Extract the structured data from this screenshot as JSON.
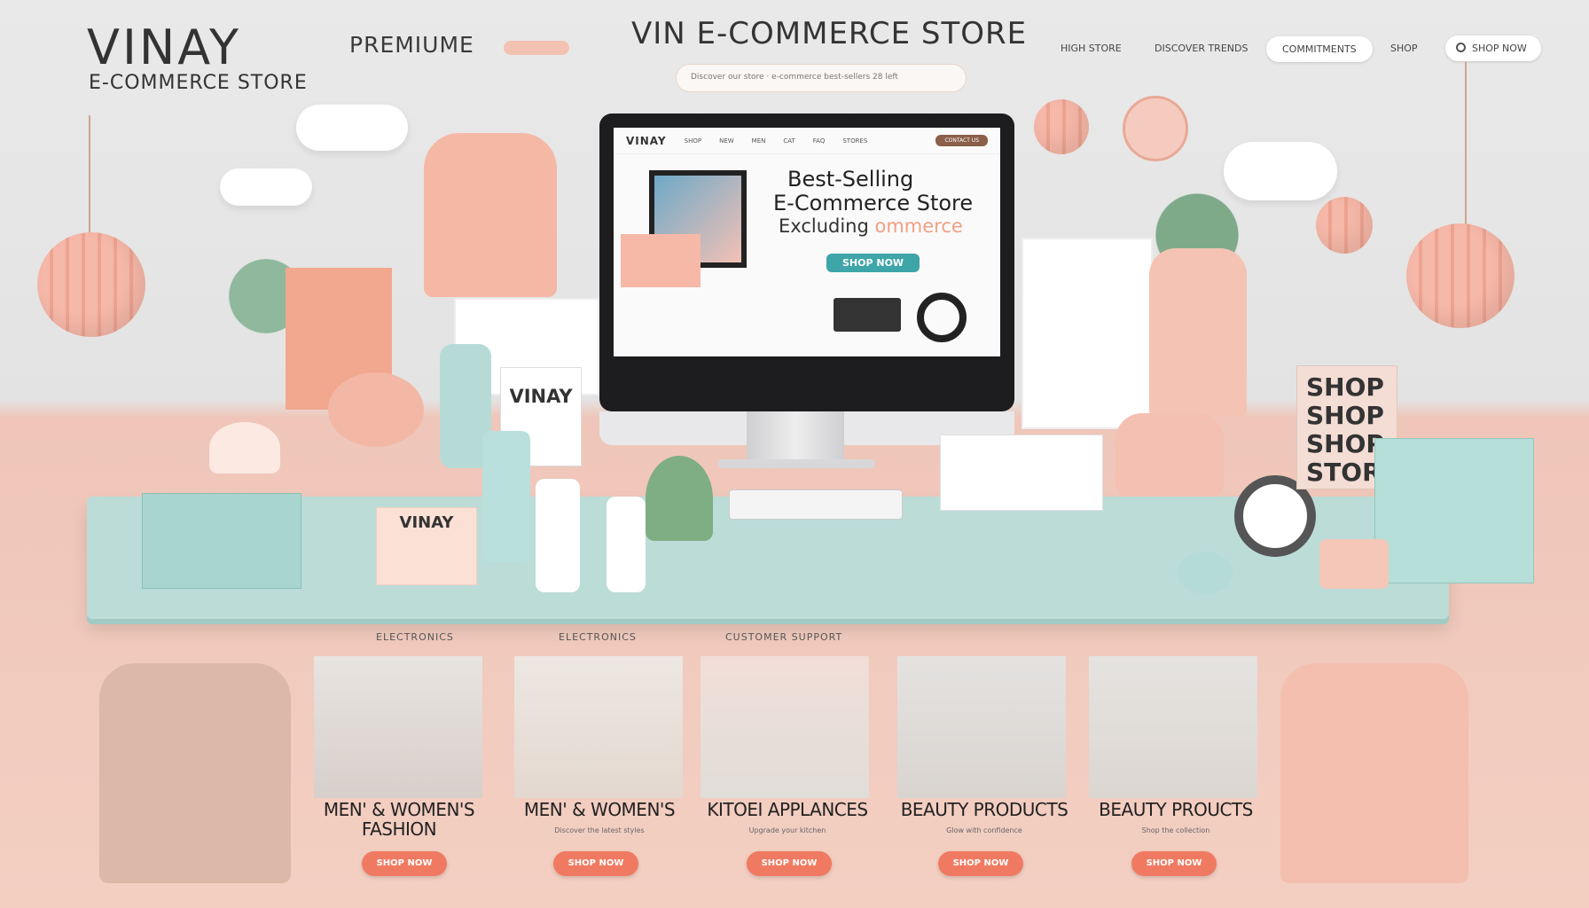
{
  "brand": {
    "name": "VINAY",
    "tagline": "E-COMMERCE STORE"
  },
  "header": {
    "premium_label": "PREMIUME",
    "title": "VIN E-COMMERCE STORE",
    "nav": [
      "HIGH STORE",
      "DISCOVER TRENDS",
      "COMMITMENTS",
      "SHOP",
      "SHOP NOW"
    ],
    "search_placeholder": "Discover our store · e-commerce best-sellers 28 left"
  },
  "screen": {
    "logo": "VINAY",
    "nav": [
      "SHOP",
      "NEW",
      "MEN",
      "CAT",
      "FAQ",
      "STORES"
    ],
    "nav_button": "CONTACT US",
    "hero_line1": "Best-Selling",
    "hero_line2": "E-Commerce Store",
    "hero_line3a": "Excluding",
    "hero_line3b": " ommerce",
    "cta": "SHOP NOW"
  },
  "props": {
    "box_label": "VINAY",
    "tray_label": "VINAY",
    "shop_box": [
      "SHOP",
      "SHOP",
      "SHOP",
      "STOR"
    ]
  },
  "categories": {
    "headings": [
      "ELECTRONICS",
      "ELECTRONICS",
      "CUSTOMER SUPPORT"
    ],
    "items": [
      {
        "title": "MEN' & WOMEN'S FASHION",
        "sub": "",
        "button": "SHOP NOW"
      },
      {
        "title": "MEN' & WOMEN'S",
        "sub": "Discover the latest styles",
        "button": "SHOP NOW"
      },
      {
        "title": "KITOEI APPLANCES",
        "sub": "Upgrade your kitchen",
        "button": "SHOP NOW"
      },
      {
        "title": "BEAUTY PRODUCTS",
        "sub": "Glow with confidence",
        "button": "SHOP NOW"
      },
      {
        "title": "BEAUTY PROUCTS",
        "sub": "Shop the collection",
        "button": "SHOP NOW"
      }
    ]
  },
  "colors": {
    "accent": "#f07a61",
    "teal": "#3ea5a8",
    "table": "#bcdcd8",
    "floor": "#f3cfc2"
  }
}
